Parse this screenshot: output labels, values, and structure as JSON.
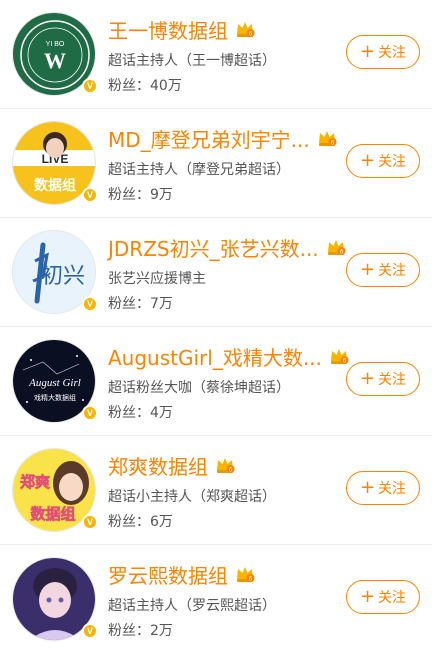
{
  "accent_color": "#ff8200",
  "badge_color": "#f7b500",
  "follow_label": "关注",
  "follow_icon": "plus-icon",
  "verified_mark": "V",
  "items": [
    {
      "name": "王一博数据组",
      "role": "超话主持人（王一博超话）",
      "fans": "粉丝：40万",
      "avatar_text": "YI BO",
      "avatar_glyph": "W",
      "avatar_colors": [
        "#1f6b46",
        "#ffffff"
      ]
    },
    {
      "name": "MD_摩登兄弟刘宇宁...",
      "role": "超话主持人（摩登兄弟超话）",
      "fans": "粉丝：9万",
      "avatar_text": "数据组",
      "avatar_glyph": "LIVE",
      "avatar_colors": [
        "#f6c21b",
        "#2c2c2c"
      ]
    },
    {
      "name": "JDRZS初兴_张艺兴数...",
      "role": "张艺兴应援博主",
      "fans": "粉丝：7万",
      "avatar_text": "初兴",
      "avatar_glyph": "",
      "avatar_colors": [
        "#e9f3fb",
        "#2b63a8"
      ]
    },
    {
      "name": "AugustGirl_戏精大数...",
      "role": "超话粉丝大咖（蔡徐坤超话）",
      "fans": "粉丝：4万",
      "avatar_text": "August Girl",
      "avatar_glyph": "戏精大数据组",
      "avatar_colors": [
        "#0b0f22",
        "#ffffff"
      ]
    },
    {
      "name": "郑爽数据组",
      "role": "超话小主持人（郑爽超话）",
      "fans": "粉丝：6万",
      "avatar_text": "郑爽",
      "avatar_glyph": "数据组",
      "avatar_colors": [
        "#f9e24a",
        "#e24d7a"
      ]
    },
    {
      "name": "罗云熙数据组",
      "role": "超话主持人（罗云熙超话）",
      "fans": "粉丝：2万",
      "avatar_text": "",
      "avatar_glyph": "",
      "avatar_colors": [
        "#3a2f6b",
        "#f2d7e0"
      ]
    }
  ]
}
